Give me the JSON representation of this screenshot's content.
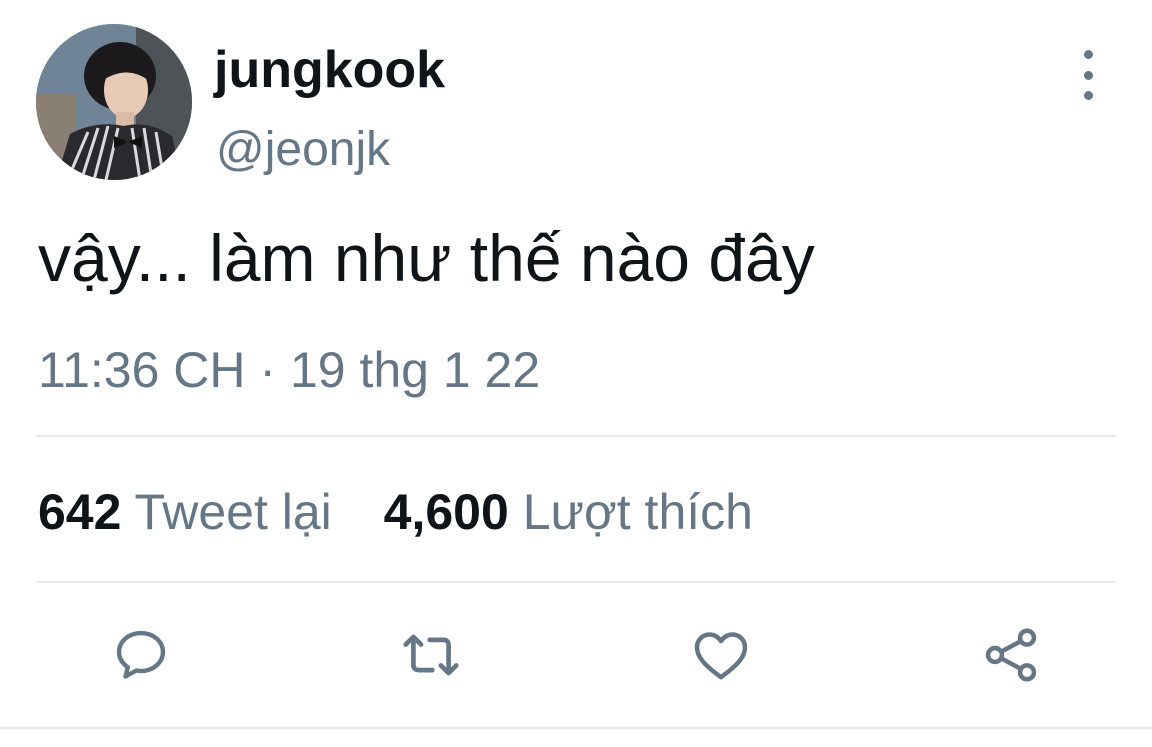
{
  "tweet": {
    "author": {
      "display_name": "jungkook",
      "handle": "@jeonjk",
      "avatar_icon": "profile-photo"
    },
    "text": "vậy... làm như thế nào đây",
    "timestamp": "11:36 CH · 19 thg 1 22",
    "stats": {
      "retweets": {
        "count": "642",
        "label": "Tweet lại"
      },
      "likes": {
        "count": "4,600",
        "label": "Lượt thích"
      }
    },
    "actions": {
      "reply_icon": "reply-icon",
      "retweet_icon": "retweet-icon",
      "like_icon": "heart-icon",
      "share_icon": "share-icon"
    }
  },
  "colors": {
    "text_primary": "#0f1419",
    "text_secondary": "#657786",
    "divider": "#e6ecf0"
  }
}
